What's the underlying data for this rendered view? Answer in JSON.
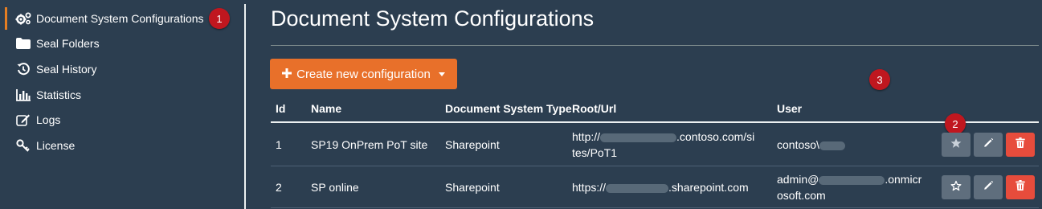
{
  "sidebar": {
    "items": [
      {
        "label": "Document System Configurations",
        "icon": "gears-icon",
        "active": true
      },
      {
        "label": "Seal Folders",
        "icon": "folder-icon"
      },
      {
        "label": "Seal History",
        "icon": "history-icon"
      },
      {
        "label": "Statistics",
        "icon": "bar-chart-icon"
      },
      {
        "label": "Logs",
        "icon": "edit-icon"
      },
      {
        "label": "License",
        "icon": "key-icon"
      }
    ]
  },
  "badges": {
    "b1": "1",
    "b2": "2",
    "b3": "3"
  },
  "main": {
    "title": "Document System Configurations",
    "create_button": "Create new configuration",
    "table": {
      "headers": [
        "Id",
        "Name",
        "Document System Type",
        "Root/Url",
        "User"
      ],
      "rows": [
        {
          "id": "1",
          "name": "SP19 OnPrem PoT site",
          "type": "Sharepoint",
          "url_a": "http://",
          "url_b": ".contoso.com/si",
          "url_c": "tes/PoT1",
          "user_a": "contoso\\",
          "user_b": ""
        },
        {
          "id": "2",
          "name": "SP online",
          "type": "Sharepoint",
          "url_a": "https://",
          "url_b": ".sharepoint.com",
          "url_c": "",
          "user_a": "admin@",
          "user_b": ".onmicr",
          "user_c": "osoft.com"
        }
      ]
    }
  },
  "colors": {
    "background": "#2c3e50",
    "accent": "#e8702a",
    "danger": "#e74c3c",
    "badge": "#c0171f"
  }
}
